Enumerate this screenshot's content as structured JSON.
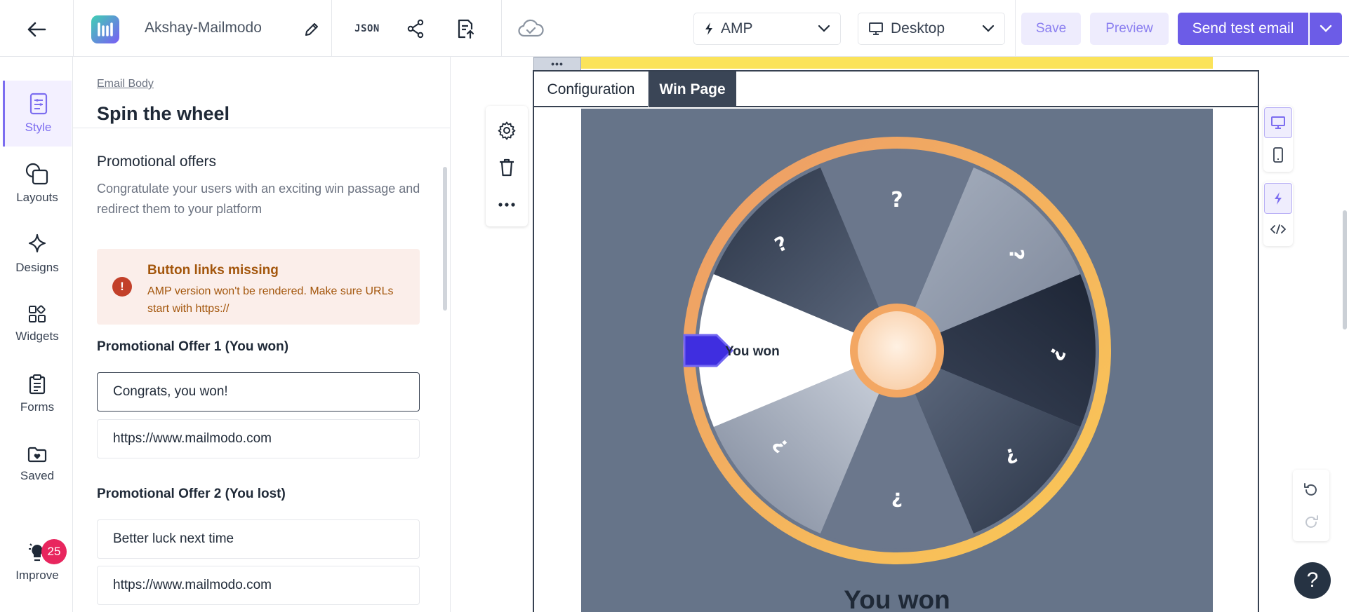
{
  "header": {
    "project_name": "Akshay-Mailmodo",
    "json_label": "JSON",
    "format_select": "AMP",
    "device_select": "Desktop",
    "save_label": "Save",
    "preview_label": "Preview",
    "send_label": "Send test email"
  },
  "rail": {
    "items": [
      {
        "label": "Style",
        "icon": "style-icon",
        "active": true
      },
      {
        "label": "Layouts",
        "icon": "layouts-icon"
      },
      {
        "label": "Designs",
        "icon": "sparkle-icon"
      },
      {
        "label": "Widgets",
        "icon": "widgets-icon"
      },
      {
        "label": "Forms",
        "icon": "clipboard-icon"
      },
      {
        "label": "Saved",
        "icon": "folder-heart-icon"
      }
    ],
    "improve_label": "Improve",
    "improve_count": "25"
  },
  "panel": {
    "breadcrumb": "Email Body",
    "title": "Spin the wheel",
    "section_title": "Promotional offers",
    "section_desc": "Congratulate your users with an exciting win passage and redirect them to your platform",
    "alert": {
      "title": "Button links missing",
      "text": "AMP version won't be rendered. Make sure URLs start with https://"
    },
    "offer1": {
      "label": "Promotional Offer 1 (You won)",
      "message": "Congrats, you won!",
      "url": "https://www.mailmodo.com"
    },
    "offer2": {
      "label": "Promotional Offer 2 (You lost)",
      "message": "Better luck next time",
      "url": "https://www.mailmodo.com"
    }
  },
  "canvas": {
    "more_label": "•••",
    "tabs": [
      "Configuration",
      "Win Page"
    ],
    "active_tab": "Win Page",
    "wheel": {
      "pointer_label": "You won",
      "segment_labels": [
        "?",
        "?",
        "?",
        "?",
        "?",
        "?",
        "?"
      ],
      "colors": {
        "rim": "#f3a763",
        "hub": "#fbdcc0",
        "pointer": "#3f2ee0",
        "background": "#667489"
      }
    },
    "result_title": "You won",
    "help_label": "?"
  }
}
